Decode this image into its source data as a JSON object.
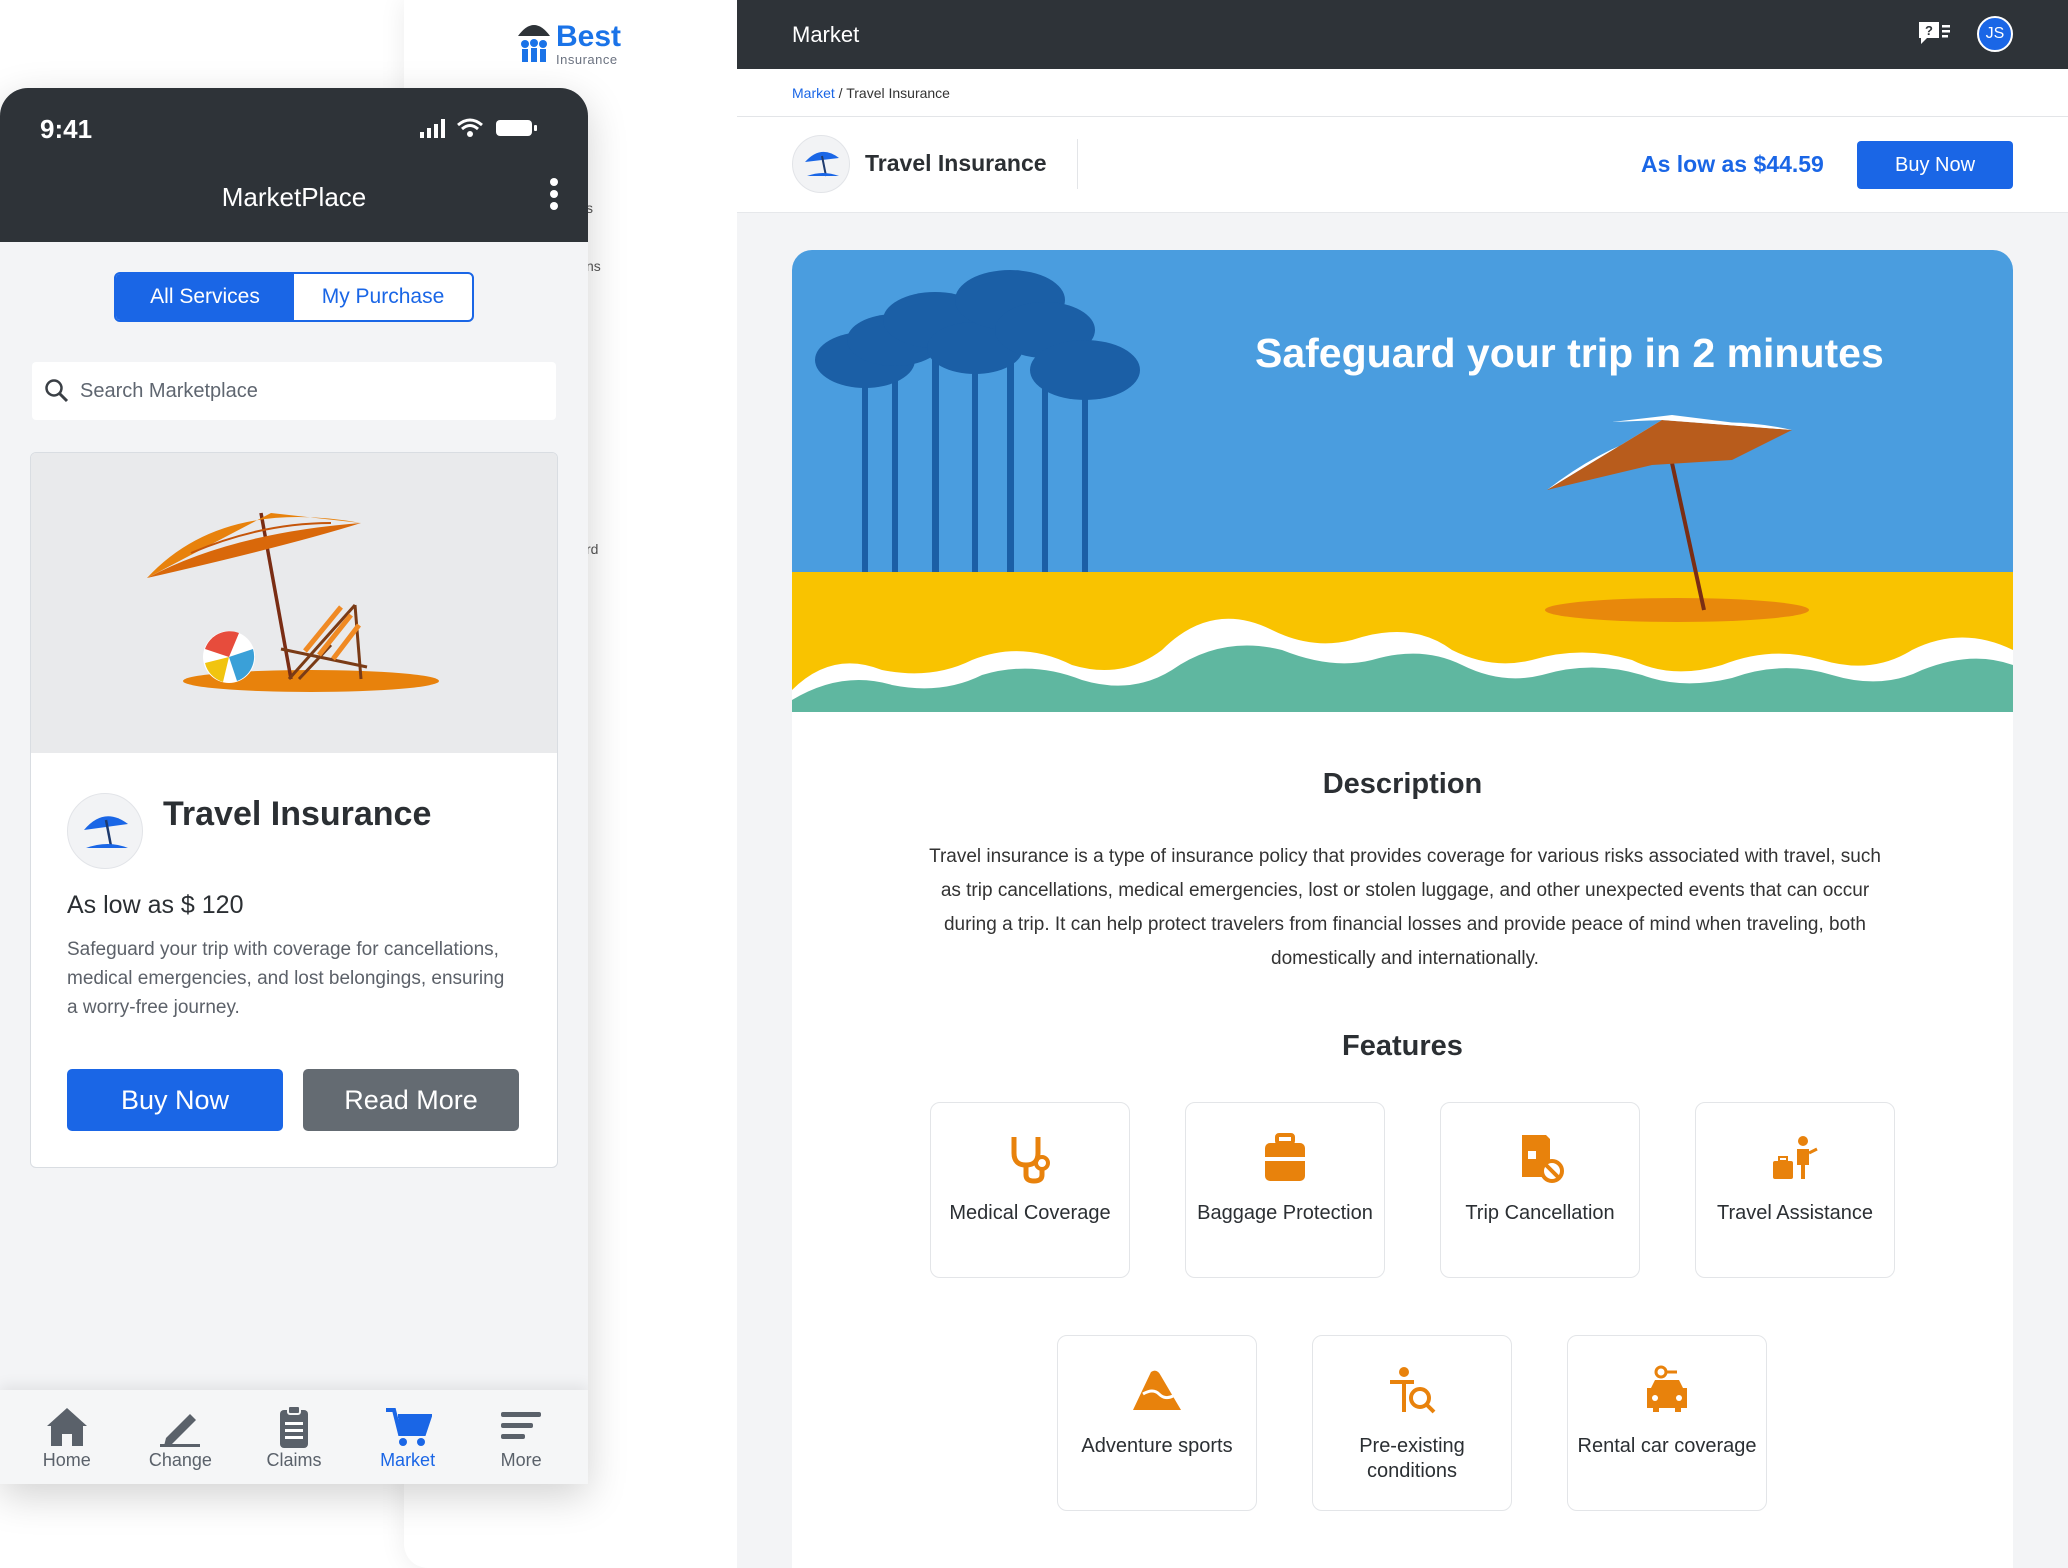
{
  "brand": {
    "name": "Best",
    "tagline": "Insurance"
  },
  "back_peek": {
    "a": "s",
    "b": "ns",
    "c": "rd"
  },
  "mobile": {
    "status_time": "9:41",
    "title": "MarketPlace",
    "segments": {
      "all": "All Services",
      "mine": "My Purchase"
    },
    "search_placeholder": "Search Marketplace",
    "card": {
      "title": "Travel Insurance",
      "price": "As low as $ 120",
      "description": "Safeguard your trip with coverage for cancellations, medical emergencies, and lost belongings, ensuring a worry-free journey.",
      "buy_label": "Buy Now",
      "read_label": "Read More"
    },
    "tabs": [
      {
        "label": "Home",
        "icon": "home-icon"
      },
      {
        "label": "Change",
        "icon": "pencil-icon"
      },
      {
        "label": "Claims",
        "icon": "clipboard-icon"
      },
      {
        "label": "Market",
        "icon": "cart-icon"
      },
      {
        "label": "More",
        "icon": "menu-icon"
      }
    ]
  },
  "desktop": {
    "top_title": "Market",
    "avatar_initials": "JS",
    "breadcrumb": {
      "root": "Market",
      "sep": " / ",
      "current": "Travel Insurance"
    },
    "product": {
      "name": "Travel Insurance",
      "price": "As low as $44.59",
      "buy_label": "Buy Now"
    },
    "hero_title": "Safeguard your trip in 2 minutes",
    "description_heading": "Description",
    "description": "Travel insurance is a type of insurance policy that provides coverage for various risks associated with travel, such as trip cancellations, medical emergencies, lost or stolen luggage, and other unexpected events that can occur during a trip. It can help protect travelers from financial losses and provide peace of mind when traveling, both domestically and internationally.",
    "features_heading": "Features",
    "features": [
      {
        "label": "Medical Coverage",
        "icon": "stethoscope-icon"
      },
      {
        "label": "Baggage Protection",
        "icon": "suitcase-icon"
      },
      {
        "label": "Trip Cancellation",
        "icon": "trip-cancel-icon"
      },
      {
        "label": "Travel Assistance",
        "icon": "traveler-icon"
      },
      {
        "label": "Adventure sports",
        "icon": "mountain-icon"
      },
      {
        "label": "Pre-existing conditions",
        "icon": "person-search-icon"
      },
      {
        "label": "Rental car coverage",
        "icon": "car-key-icon"
      }
    ]
  },
  "colors": {
    "primary": "#1a66e6",
    "header": "#2e3338",
    "accent": "#e8820c",
    "sky": "#4a9ddf",
    "sand": "#f9c300",
    "sea": "#5fb7a0"
  }
}
